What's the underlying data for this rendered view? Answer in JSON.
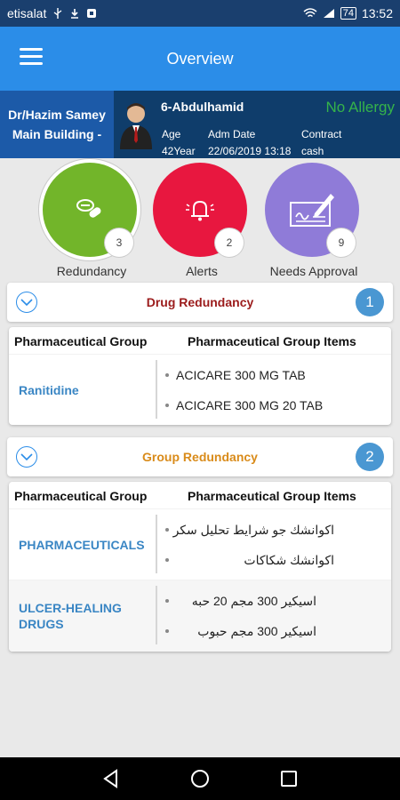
{
  "status_bar": {
    "carrier": "etisalat",
    "battery": "74",
    "time": "13:52"
  },
  "app_bar": {
    "title": "Overview"
  },
  "patient": {
    "doctor_line1": "Dr/Hazim Samey",
    "doctor_line2": "Main Building  -",
    "name": "6-Abdulhamid",
    "allergy": "No Allergy",
    "age_label": "Age",
    "age_value": "42Year",
    "adm_label": "Adm Date",
    "adm_value": "22/06/2019 13:18",
    "contract_label": "Contract",
    "contract_value": "cash"
  },
  "tiles": [
    {
      "label": "Redundancy",
      "count": "3",
      "icon": "pills-icon",
      "color": "#72b52a"
    },
    {
      "label": "Alerts",
      "count": "2",
      "icon": "bell-icon",
      "color": "#e8173f"
    },
    {
      "label": "Needs Approval",
      "count": "9",
      "icon": "signature-icon",
      "color": "#8f7bd8"
    }
  ],
  "drug_redundancy": {
    "title": "Drug Redundancy",
    "count": "1",
    "title_color": "#9b1b1b",
    "col1": "Pharmaceutical Group",
    "col2": "Pharmaceutical Group Items",
    "rows": [
      {
        "group": "Ranitidine",
        "items": [
          "ACICARE  300 MG TAB",
          "ACICARE 300 MG 20 TAB"
        ]
      }
    ]
  },
  "group_redundancy": {
    "title": "Group Redundancy",
    "count": "2",
    "title_color": "#d98b1a",
    "col1": "Pharmaceutical Group",
    "col2": "Pharmaceutical Group Items",
    "rows": [
      {
        "group": "PHARMACEUTICALS",
        "items": [
          "اكوانشك جو شرايط تحليل سكر",
          "اكوانشك شكاكات"
        ]
      },
      {
        "group": "ULCER-HEALING DRUGS",
        "items": [
          "اسيكير 300 مجم 20 حبه",
          "اسيكير 300 مجم حبوب"
        ]
      }
    ]
  }
}
